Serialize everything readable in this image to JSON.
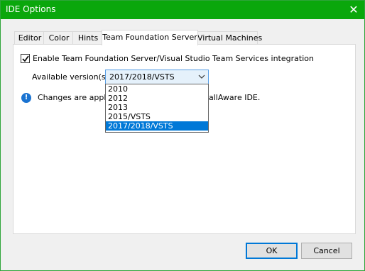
{
  "window": {
    "title": "IDE Options",
    "close_glyph": "✕"
  },
  "tabs": [
    {
      "label": "Editor",
      "active": false
    },
    {
      "label": "Color",
      "active": false
    },
    {
      "label": "Hints",
      "active": false
    },
    {
      "label": "Team Foundation Server",
      "active": true
    },
    {
      "label": "Virtual Machines",
      "active": false
    }
  ],
  "tfs": {
    "enable_label": "Enable Team Foundation Server/Visual Studio Team Services integration",
    "enable_checked": true,
    "version_label": "Available version(s):",
    "selected_version": "2017/2018/VSTS",
    "version_options": [
      "2010",
      "2012",
      "2013",
      "2015/VSTS",
      "2017/2018/VSTS"
    ],
    "info_icon": "info-icon",
    "info_text": "Changes are applied at the next start of the AdvancedInstaller/AdvancedInstaller AwareAware IDE.",
    "info_text_visible_left": "Changes are applied",
    "info_text_visible_right": "allAware IDE."
  },
  "buttons": {
    "ok": "OK",
    "cancel": "Cancel"
  },
  "colors": {
    "titlebar": "#0aa70c",
    "selection": "#0078d7",
    "info": "#1a73d1"
  }
}
